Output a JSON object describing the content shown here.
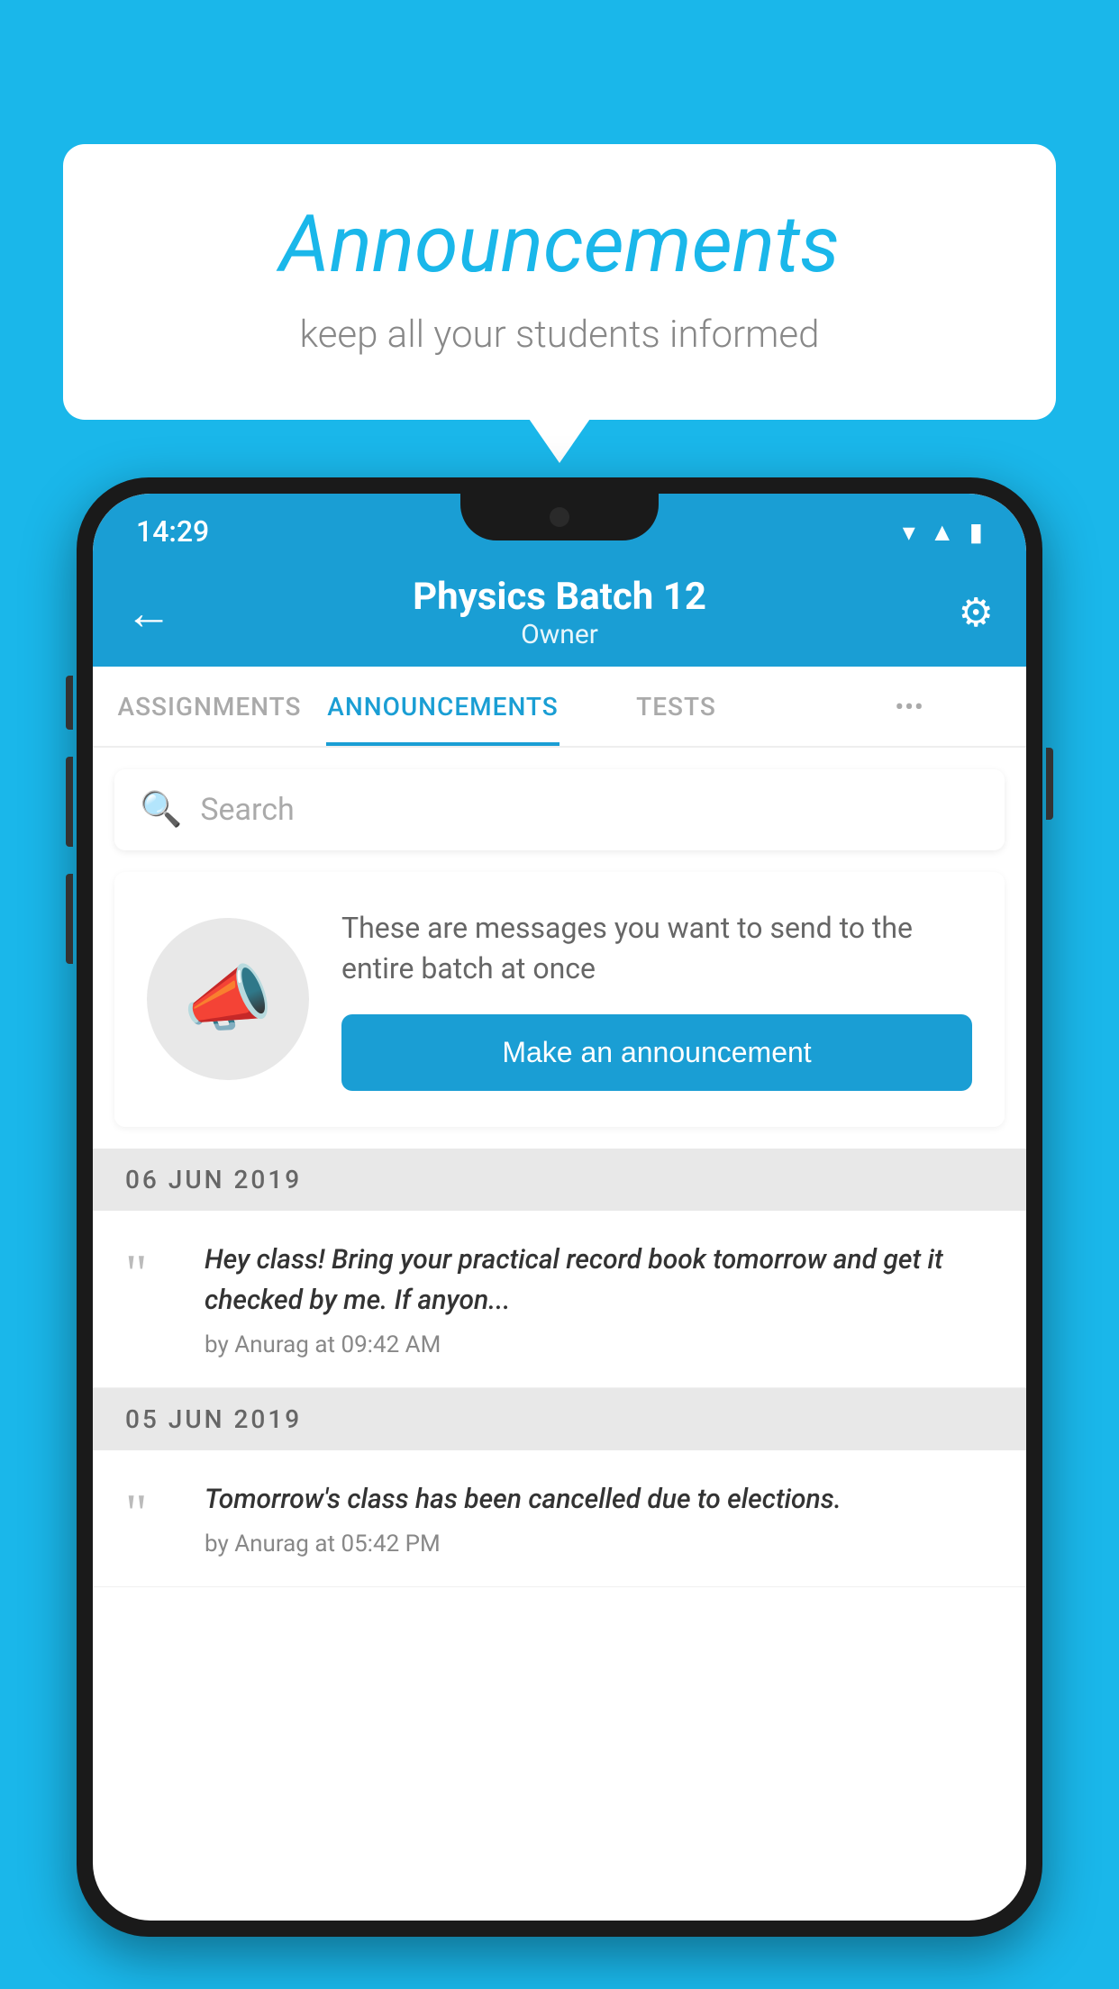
{
  "bubble": {
    "title": "Announcements",
    "subtitle": "keep all your students informed"
  },
  "statusBar": {
    "time": "14:29",
    "icons": [
      "wifi",
      "signal",
      "battery"
    ]
  },
  "appBar": {
    "title": "Physics Batch 12",
    "subtitle": "Owner",
    "backLabel": "←",
    "gearLabel": "⚙"
  },
  "tabs": [
    {
      "label": "ASSIGNMENTS",
      "active": false
    },
    {
      "label": "ANNOUNCEMENTS",
      "active": true
    },
    {
      "label": "TESTS",
      "active": false
    },
    {
      "label": "•••",
      "active": false
    }
  ],
  "search": {
    "placeholder": "Search"
  },
  "promo": {
    "description": "These are messages you want to send to the entire batch at once",
    "buttonLabel": "Make an announcement"
  },
  "announcements": [
    {
      "date": "06  JUN  2019",
      "text": "Hey class! Bring your practical record book tomorrow and get it checked by me. If anyon...",
      "meta": "by Anurag at 09:42 AM"
    },
    {
      "date": "05  JUN  2019",
      "text": "Tomorrow's class has been cancelled due to elections.",
      "meta": "by Anurag at 05:42 PM"
    }
  ]
}
